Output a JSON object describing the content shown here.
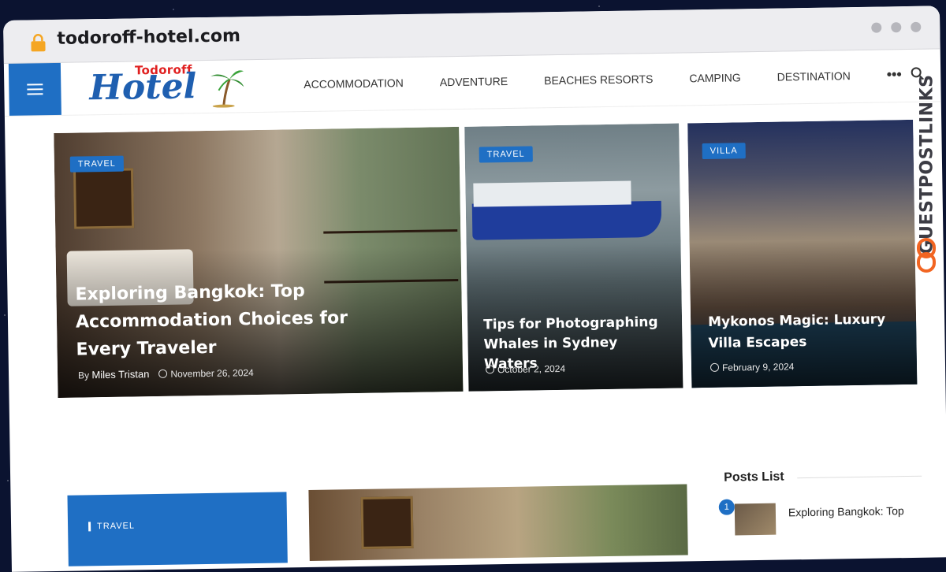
{
  "browser": {
    "url": "todoroff-hotel.com"
  },
  "logo": {
    "top": "Todoroff",
    "main": "Hotel"
  },
  "nav": {
    "items": [
      "ACCOMMODATION",
      "ADVENTURE",
      "BEACHES RESORTS",
      "CAMPING",
      "DESTINATION"
    ],
    "more": "•••"
  },
  "hero": [
    {
      "tag": "TRAVEL",
      "title": "Exploring Bangkok: Top Accommodation Choices for Every Traveler",
      "by": "By",
      "author": "Miles Tristan",
      "date": "November 26, 2024"
    },
    {
      "tag": "TRAVEL",
      "title": "Tips for Photographing Whales in Sydney Waters",
      "date": "October 2, 2024"
    },
    {
      "tag": "VILLA",
      "title": "Mykonos Magic: Luxury Villa Escapes",
      "date": "February 9, 2024"
    }
  ],
  "lower": {
    "tag": "TRAVEL"
  },
  "posts_list": {
    "title": "Posts List",
    "items": [
      {
        "num": "1",
        "title": "Exploring Bangkok: Top"
      }
    ]
  },
  "watermark": "GUESTPOSTLINKS",
  "colors": {
    "accent": "#1f6fc4",
    "logo_red": "#e02020"
  }
}
